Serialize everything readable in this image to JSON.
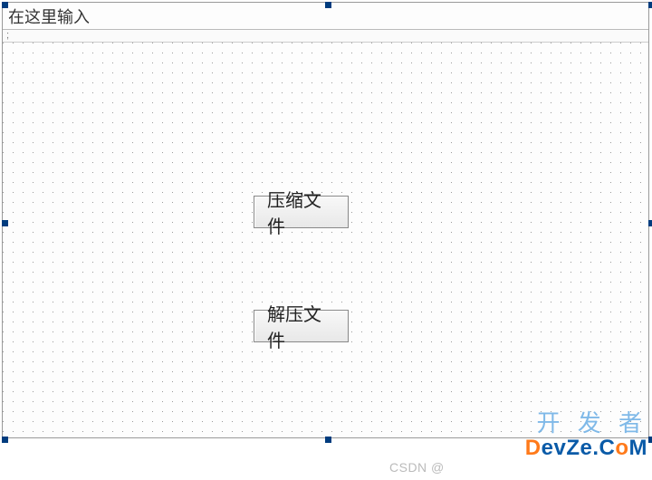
{
  "title": "在这里输入",
  "status_text": ";",
  "buttons": {
    "compress": "压缩文件",
    "decompress": "解压文件"
  },
  "watermark": {
    "csdn": "CSDN @",
    "devze_top": "开 发 者",
    "devze_main": "evZe.C",
    "devze_d": "D",
    "devze_o": "o",
    "devze_m": "M"
  }
}
